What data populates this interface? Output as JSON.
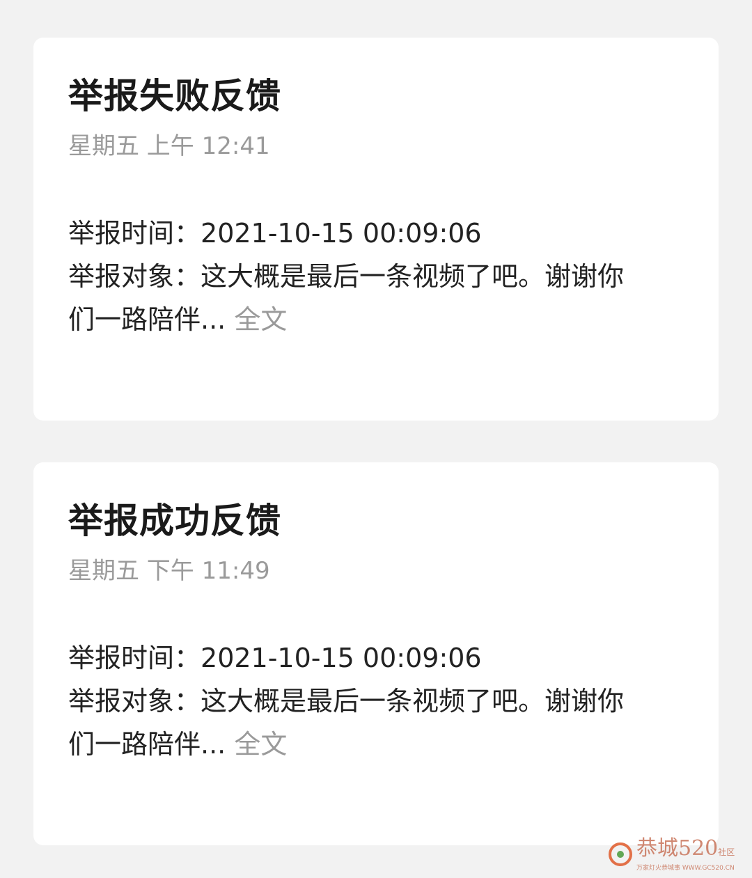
{
  "cards": [
    {
      "title": "举报失败反馈",
      "time": "星期五 上午 12:41",
      "report_time_label": "举报时间：",
      "report_time_value": "2021-10-15 00:09:06",
      "report_target_label": "举报对象：",
      "report_target_value_line1": "这大概是最后一条视频了吧。谢谢你",
      "report_target_value_line2": "们一路陪伴...",
      "more_label": "全文"
    },
    {
      "title": "举报成功反馈",
      "time": "星期五 下午 11:49",
      "report_time_label": "举报时间：",
      "report_time_value": "2021-10-15 00:09:06",
      "report_target_label": "举报对象：",
      "report_target_value_line1": "这大概是最后一条视频了吧。谢谢你",
      "report_target_value_line2": "们一路陪伴...",
      "more_label": "全文"
    }
  ],
  "watermark": {
    "main": "恭城520",
    "side": "社区",
    "sub": "万家灯火恭城事 WWW.GC520.CN"
  }
}
